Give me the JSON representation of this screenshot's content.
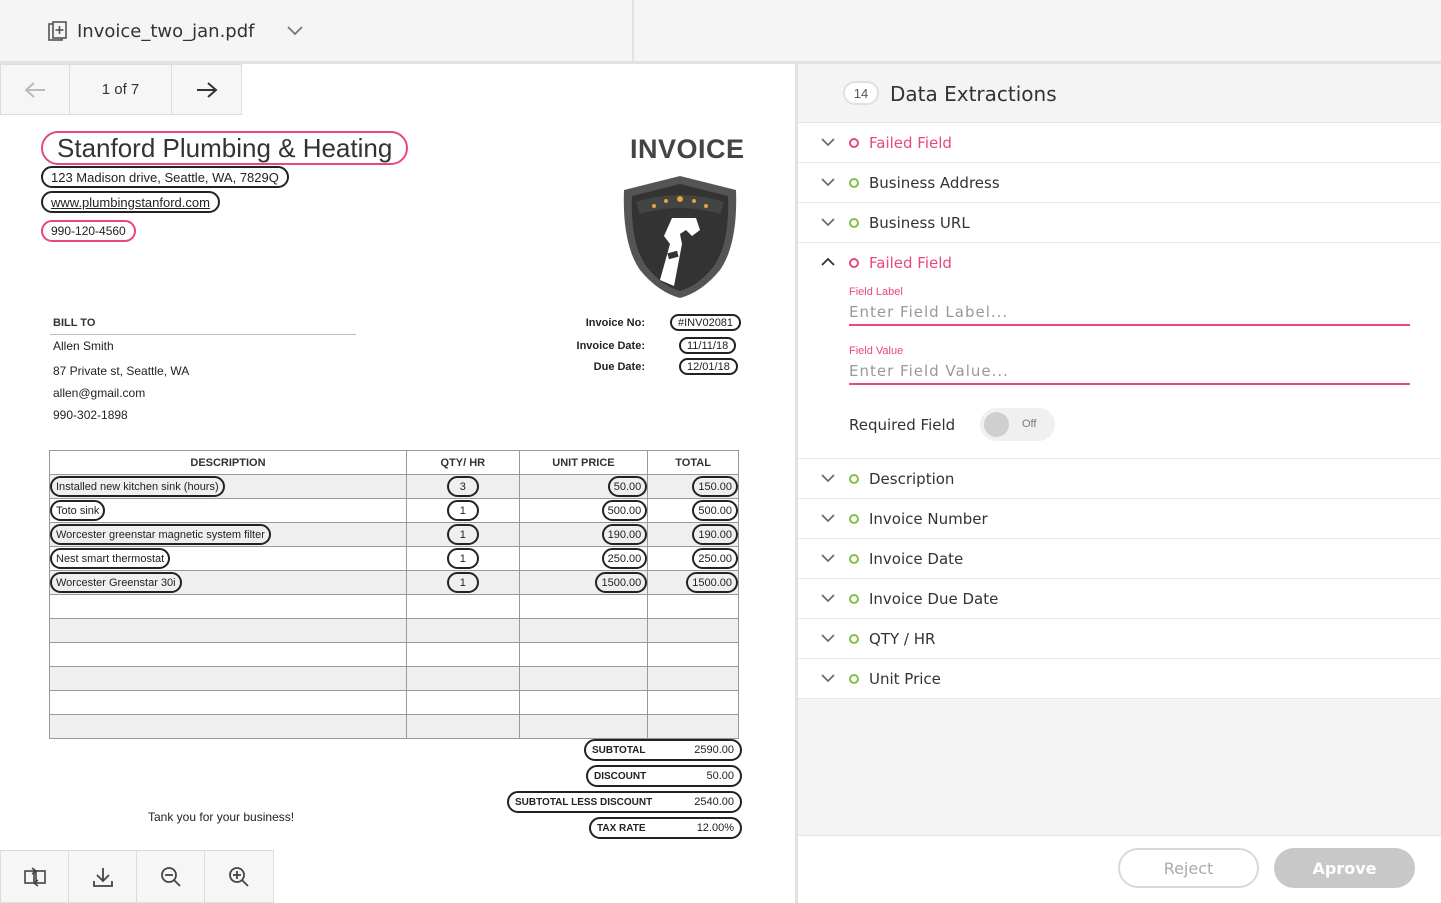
{
  "file": {
    "name": "Invoice_two_jan.pdf",
    "icon": "file-plus-icon"
  },
  "pager": {
    "label": "1 of 7"
  },
  "invoice": {
    "business_name": "Stanford Plumbing & Heating",
    "address": "123 Madison drive, Seattle, WA, 7829Q",
    "url": "www.plumbingstanford.com",
    "phone": "990-120-4560",
    "title": "INVOICE",
    "bill_to": {
      "label": "BILL TO",
      "name": "Allen Smith",
      "street": "87 Private st, Seattle, WA",
      "email": "allen@gmail.com",
      "phone": "990-302-1898"
    },
    "meta": {
      "invoice_no_label": "Invoice No:",
      "invoice_no": "#INV02081",
      "invoice_date_label": "Invoice Date:",
      "invoice_date": "11/11/18",
      "due_date_label": "Due Date:",
      "due_date": "12/01/18"
    },
    "columns": [
      "DESCRIPTION",
      "QTY/ HR",
      "UNIT PRICE",
      "TOTAL"
    ],
    "items": [
      {
        "description": "Installed new kitchen sink (hours)",
        "qty": "3",
        "unit_price": "50.00",
        "total": "150.00"
      },
      {
        "description": "Toto sink",
        "qty": "1",
        "unit_price": "500.00",
        "total": "500.00"
      },
      {
        "description": "Worcester greenstar magnetic system filter",
        "qty": "1",
        "unit_price": "190.00",
        "total": "190.00"
      },
      {
        "description": "Nest smart thermostat",
        "qty": "1",
        "unit_price": "250.00",
        "total": "250.00"
      },
      {
        "description": "Worcester Greenstar 30i",
        "qty": "1",
        "unit_price": "1500.00",
        "total": "1500.00"
      }
    ],
    "totals": {
      "subtotal_label": "SUBTOTAL",
      "subtotal": "2590.00",
      "discount_label": "DISCOUNT",
      "discount": "50.00",
      "less_label": "SUBTOTAL LESS DISCOUNT",
      "less": "2540.00",
      "tax_label": "TAX RATE",
      "tax": "12.00%"
    },
    "thanks": "Tank you for your business!"
  },
  "panel": {
    "count": "14",
    "title": "Data Extractions",
    "fields_top": [
      {
        "label": "Failed Field",
        "status": "failed"
      },
      {
        "label": "Business Address",
        "status": "ok"
      },
      {
        "label": "Business URL",
        "status": "ok"
      }
    ],
    "expanded": {
      "label": "Failed Field",
      "field_label_caption": "Field Label",
      "field_label_placeholder": "Enter Field Label...",
      "field_value_caption": "Field Value",
      "field_value_placeholder": "Enter Field Value...",
      "required_label": "Required Field",
      "toggle_state": "Off"
    },
    "fields_bottom": [
      {
        "label": "Description",
        "status": "ok"
      },
      {
        "label": "Invoice Number",
        "status": "ok"
      },
      {
        "label": "Invoice Date",
        "status": "ok"
      },
      {
        "label": "Invoice Due Date",
        "status": "ok"
      },
      {
        "label": "QTY / HR",
        "status": "ok"
      },
      {
        "label": "Unit Price",
        "status": "ok"
      }
    ],
    "reject_label": "Reject",
    "approve_label": "Aprove"
  },
  "colors": {
    "failed": "#e8497a",
    "ok": "#7fc241",
    "approve_bg": "#c8c8c8"
  }
}
